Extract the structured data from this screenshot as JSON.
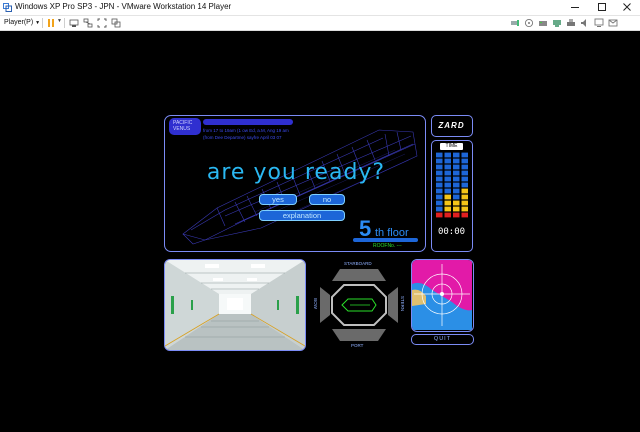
{
  "window": {
    "title": "Windows XP Pro SP3 - JPN - VMware Workstation 14 Player",
    "player_menu": "Player(P)",
    "colors": {
      "pause_icon": "#f2a31a"
    }
  },
  "game": {
    "header_label": "PACIFIC\nVENUS",
    "info_lines": [
      "from 17 to 19am (1 ow Ed, a.M, Ang 19 am",
      "(from Dee Departme) sayfre April 03 07"
    ],
    "headline": "are you ready?",
    "yes_label": "yes",
    "no_label": "no",
    "explanation_label": "explanation",
    "floor_number": "5",
    "floor_suffix": "th floor",
    "roof_label": "ROOFNo.  ---",
    "logo": "ZARD",
    "time_label": "TIME",
    "time_value": "00:00",
    "time_meter": {
      "columns": 4,
      "rows": 11,
      "lit": [
        [
          0,
          1
        ],
        [
          0,
          4
        ],
        [
          0,
          3
        ],
        [
          0,
          5
        ]
      ]
    },
    "directions": {
      "top": "STARBOARD",
      "bottom": "PORT",
      "left": "BOW",
      "right": "STERN"
    },
    "quit_label": "QUIT",
    "colors": {
      "accent": "#2ab8f2",
      "frame": "#7b8bf5",
      "button": "#1d66d8",
      "radar_pink": "#e21aa8",
      "radar_blue": "#2b8fe6"
    }
  }
}
